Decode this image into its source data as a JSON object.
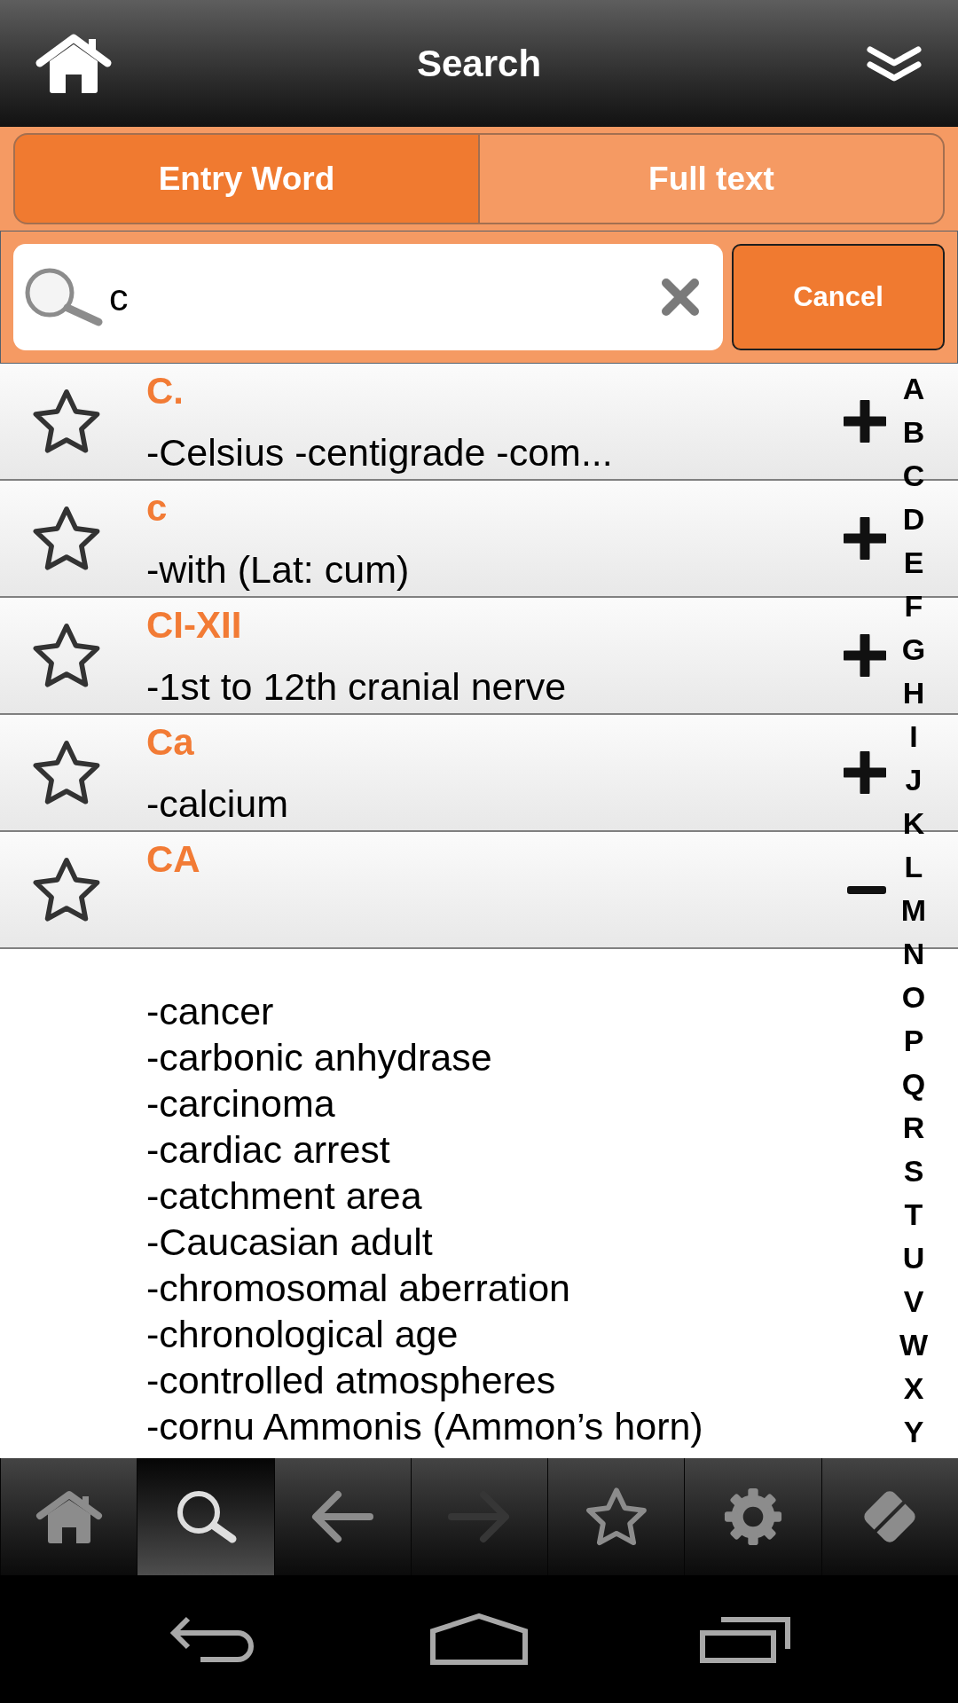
{
  "header": {
    "title": "Search"
  },
  "tabs": [
    {
      "label": "Entry Word",
      "selected": true
    },
    {
      "label": "Full text",
      "selected": false
    }
  ],
  "search": {
    "value": "c",
    "button": "Cancel"
  },
  "entries": [
    {
      "headword": "C.",
      "definition": "-Celsius -centigrade -com...",
      "starred": false,
      "expanded": false
    },
    {
      "headword": "c",
      "definition": "-with (Lat: cum)",
      "starred": false,
      "expanded": false
    },
    {
      "headword": "CI-XII",
      "definition": "-1st to 12th cranial nerve",
      "starred": false,
      "expanded": false
    },
    {
      "headword": "Ca",
      "definition": "-calcium",
      "starred": false,
      "expanded": false
    },
    {
      "headword": "CA",
      "starred": false,
      "expanded": true,
      "senses": [
        "-cancer",
        "-carbonic anhydrase",
        "-carcinoma",
        "-cardiac arrest",
        "-catchment area",
        "-Caucasian adult",
        "-chromosomal aberration",
        "-chronological age",
        "-controlled atmospheres",
        "-cornu Ammonis (Ammon’s horn)"
      ]
    }
  ],
  "alphabet_index": [
    "A",
    "B",
    "C",
    "D",
    "E",
    "F",
    "G",
    "H",
    "I",
    "J",
    "K",
    "L",
    "M",
    "N",
    "O",
    "P",
    "Q",
    "R",
    "S",
    "T",
    "U",
    "V",
    "W",
    "X",
    "Y"
  ],
  "toolbar": [
    {
      "kind": "home",
      "selected": false,
      "disabled": false
    },
    {
      "kind": "search",
      "selected": true,
      "disabled": false
    },
    {
      "kind": "back",
      "selected": false,
      "disabled": false
    },
    {
      "kind": "forward",
      "selected": false,
      "disabled": true
    },
    {
      "kind": "favorites",
      "selected": false,
      "disabled": false
    },
    {
      "kind": "settings",
      "selected": false,
      "disabled": false
    },
    {
      "kind": "eraser",
      "selected": false,
      "disabled": false
    }
  ],
  "system_nav": [
    {
      "kind": "back"
    },
    {
      "kind": "home"
    },
    {
      "kind": "recents"
    }
  ]
}
